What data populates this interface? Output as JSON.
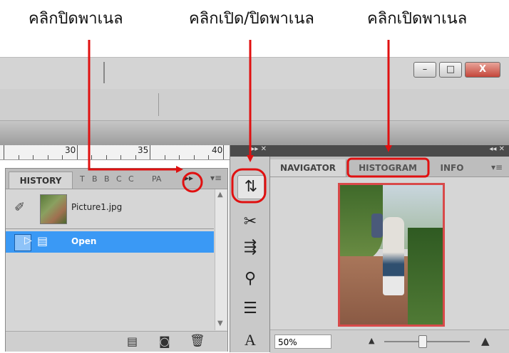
{
  "captions": {
    "close_panel": "คลิกปิดพาเนล",
    "toggle_panel": "คลิกเปิด/ปิดพาเนล",
    "open_panel": "คลิกเปิดพาเนล"
  },
  "window_controls": {
    "minimize": "–",
    "maximize": "□",
    "close": "X"
  },
  "ruler": {
    "labels": [
      "30",
      "35",
      "40"
    ]
  },
  "history_panel": {
    "active_tab": "HISTORY",
    "mini_tabs": [
      "T",
      "B",
      "B",
      "C",
      "C",
      "PA"
    ],
    "snapshot_name": "Picture1.jpg",
    "state_label": "Open",
    "collapse_button": "▸▸"
  },
  "dock": {
    "collapse_glyph": "▸▸ ✕"
  },
  "navigator_panel": {
    "top_glyph": "◂◂ ✕",
    "tabs": [
      "NAVIGATOR",
      "HISTOGRAM",
      "INFO"
    ],
    "zoom_value": "50%"
  },
  "colors": {
    "highlight_red": "#e01010",
    "selection_blue": "#3a99f5",
    "preview_border": "#d84a4a"
  }
}
